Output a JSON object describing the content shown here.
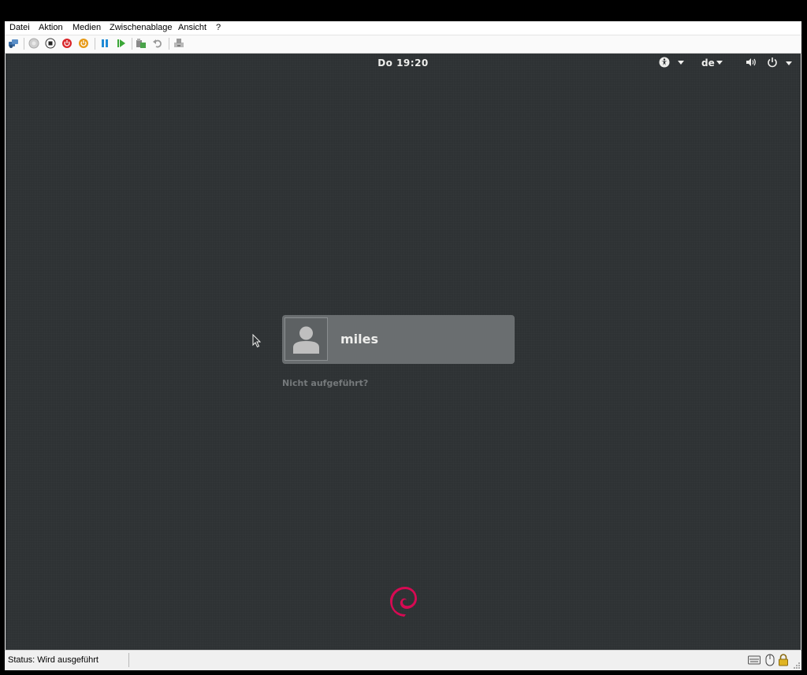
{
  "menu": [
    "Datei",
    "Aktion",
    "Medien",
    "Zwischenablage",
    "Ansicht",
    "?"
  ],
  "toolbar": {
    "icons": [
      "ctrl-alt-del-icon",
      "start-icon",
      "turn-off-icon",
      "shut-down-icon",
      "save-state-icon",
      "pause-icon",
      "reset-icon",
      "checkpoint-icon",
      "revert-icon",
      "enhanced-session-icon"
    ]
  },
  "guest": {
    "clock": "Do 19:20",
    "language": "de",
    "username": "miles",
    "not_listed": "Nicht aufgeführt?"
  },
  "status": {
    "text": "Status: Wird ausgeführt"
  },
  "colors": {
    "background": "#2e3234",
    "user_box": "#6a6e70",
    "debian_red": "#d70a53"
  }
}
